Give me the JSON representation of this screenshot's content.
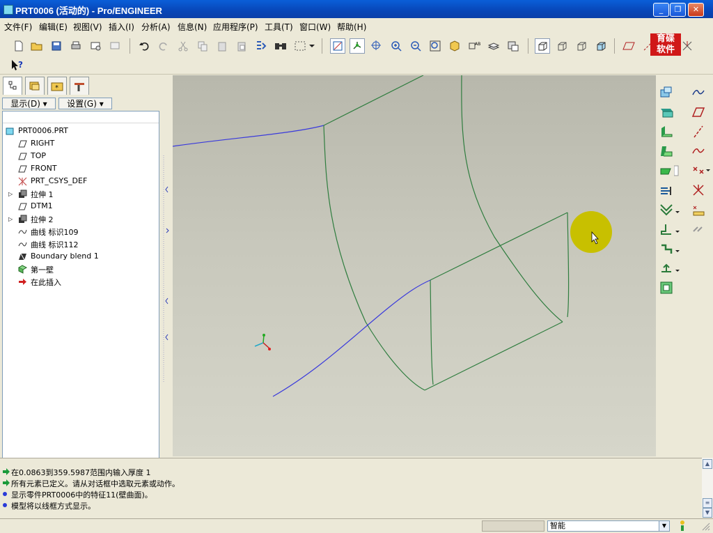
{
  "window": {
    "title": "PRT0006 (活动的) - Pro/ENGINEER",
    "minimize": "_",
    "restore": "❐",
    "close": "✕"
  },
  "menu": [
    "文件(F)",
    "编辑(E)",
    "视图(V)",
    "插入(I)",
    "分析(A)",
    "信息(N)",
    "应用程序(P)",
    "工具(T)",
    "窗口(W)",
    "帮助(H)"
  ],
  "logo": {
    "line1": "育碟",
    "line2": "软件"
  },
  "panel": {
    "show_button": "显示(D) ▾",
    "settings_button": "设置(G) ▾"
  },
  "tree": [
    {
      "label": "PRT0006.PRT",
      "icon": "part-icon",
      "indent": 0,
      "expand": false
    },
    {
      "label": "RIGHT",
      "icon": "datum-plane-icon",
      "indent": 1,
      "expand": false
    },
    {
      "label": "TOP",
      "icon": "datum-plane-icon",
      "indent": 1,
      "expand": false
    },
    {
      "label": "FRONT",
      "icon": "datum-plane-icon",
      "indent": 1,
      "expand": false
    },
    {
      "label": "PRT_CSYS_DEF",
      "icon": "csys-icon",
      "indent": 1,
      "expand": false
    },
    {
      "label": "拉伸 1",
      "icon": "extrude-icon",
      "indent": 1,
      "expand": true
    },
    {
      "label": "DTM1",
      "icon": "datum-plane-icon",
      "indent": 1,
      "expand": false
    },
    {
      "label": "拉伸 2",
      "icon": "extrude-icon",
      "indent": 1,
      "expand": true
    },
    {
      "label": "曲线 标识109",
      "icon": "curve-icon",
      "indent": 1,
      "expand": false
    },
    {
      "label": "曲线 标识112",
      "icon": "curve-icon",
      "indent": 1,
      "expand": false
    },
    {
      "label": "Boundary blend 1",
      "icon": "boundary-blend-icon",
      "indent": 1,
      "expand": false
    },
    {
      "label": "第一壁",
      "icon": "first-wall-icon",
      "indent": 1,
      "expand": false
    },
    {
      "label": "在此插入",
      "icon": "insert-here-icon",
      "indent": 1,
      "expand": false
    }
  ],
  "messages": [
    {
      "type": "prompt",
      "text": "在0.0863到359.5987范围内输入厚度  1"
    },
    {
      "type": "prompt",
      "text": "所有元素已定义。请从对话框中选取元素或动作。"
    },
    {
      "type": "info",
      "text": "显示零件PRT0006中的特征11(壁曲面)。"
    },
    {
      "type": "info",
      "text": "模型将以线框方式显示。"
    }
  ],
  "status": {
    "filter_value": "智能"
  },
  "colors": {
    "edge": "#2f7d3f",
    "curve": "#3a3adc",
    "highlight": "#c8c000"
  }
}
